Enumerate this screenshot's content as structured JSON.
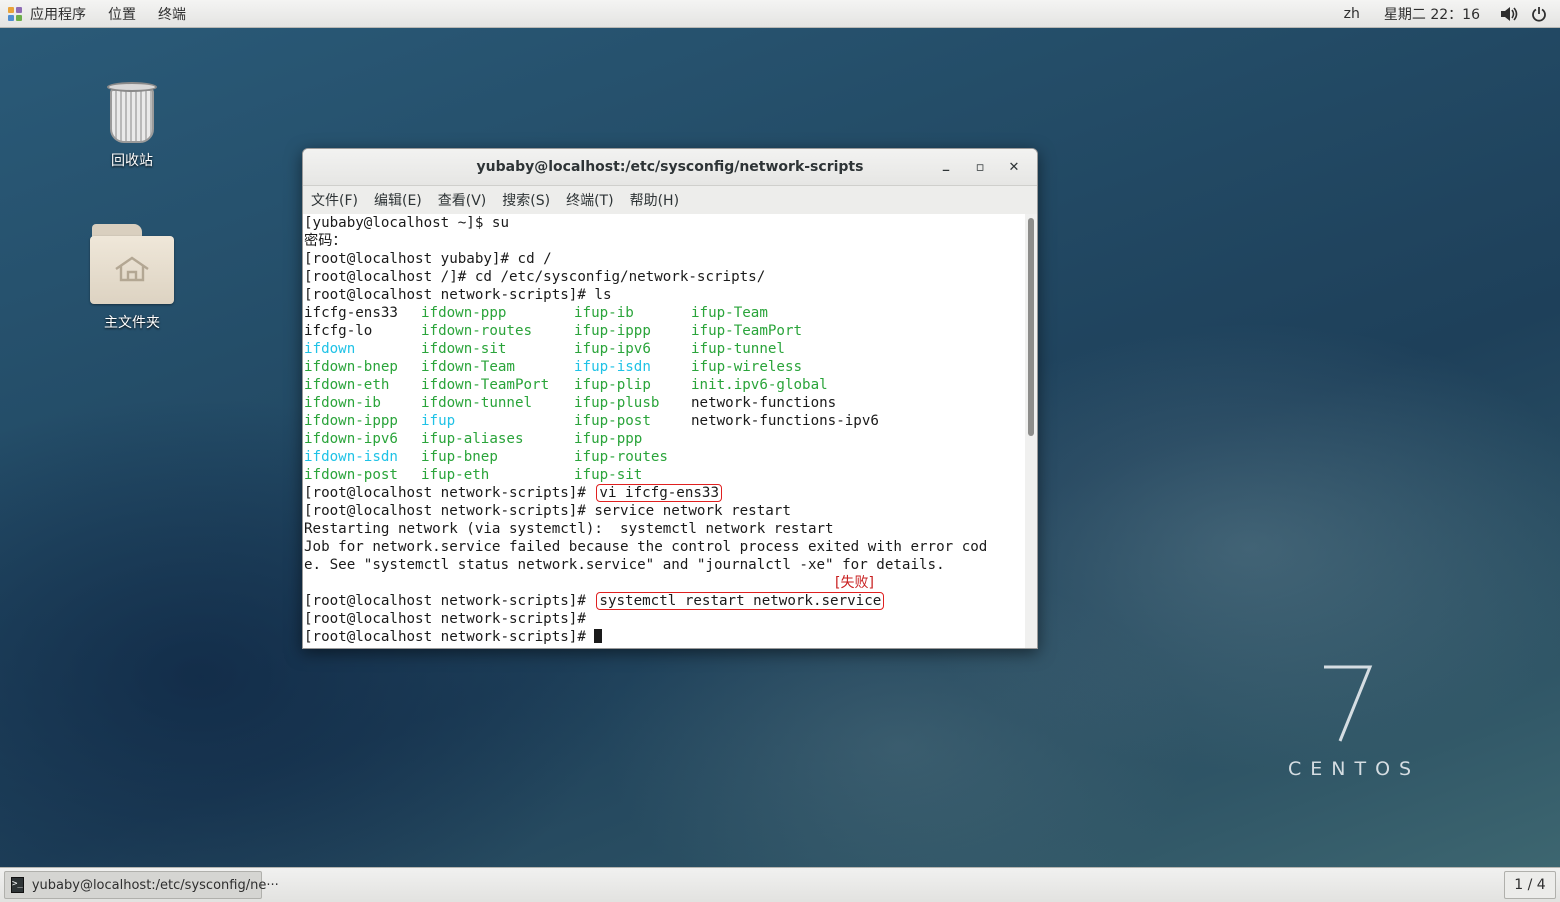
{
  "topbar": {
    "apps_label": "应用程序",
    "places_label": "位置",
    "terminal_label": "终端",
    "input_method": "zh",
    "clock": "星期二 22：16",
    "icons": [
      "apps-icon",
      "volume-icon",
      "power-icon"
    ]
  },
  "desktop": {
    "trash_label": "回收站",
    "home_label": "主文件夹"
  },
  "window": {
    "title": "yubaby@localhost:/etc/sysconfig/network-scripts",
    "controls": [
      "minimize",
      "maximize",
      "close"
    ],
    "minimize_glyph": "_",
    "maximize_glyph": "▫",
    "close_glyph": "✕"
  },
  "menubar": [
    "文件(F)",
    "编辑(E)",
    "查看(V)",
    "搜索(S)",
    "终端(T)",
    "帮助(H)"
  ],
  "terminal": {
    "lines_before_ls": [
      "[yubaby@localhost ~]$ su",
      "密码：",
      "[root@localhost yubaby]# cd /",
      "[root@localhost /]# cd /etc/sysconfig/network-scripts/",
      "[root@localhost network-scripts]# ls"
    ],
    "ls_rows": [
      [
        {
          "t": "ifcfg-ens33",
          "c": "k"
        },
        {
          "t": "ifdown-ppp",
          "c": "g"
        },
        {
          "t": "ifup-ib",
          "c": "g"
        },
        {
          "t": "ifup-Team",
          "c": "g"
        }
      ],
      [
        {
          "t": "ifcfg-lo",
          "c": "k"
        },
        {
          "t": "ifdown-routes",
          "c": "g"
        },
        {
          "t": "ifup-ippp",
          "c": "g"
        },
        {
          "t": "ifup-TeamPort",
          "c": "g"
        }
      ],
      [
        {
          "t": "ifdown",
          "c": "cy"
        },
        {
          "t": "ifdown-sit",
          "c": "g"
        },
        {
          "t": "ifup-ipv6",
          "c": "g"
        },
        {
          "t": "ifup-tunnel",
          "c": "g"
        }
      ],
      [
        {
          "t": "ifdown-bnep",
          "c": "g"
        },
        {
          "t": "ifdown-Team",
          "c": "g"
        },
        {
          "t": "ifup-isdn",
          "c": "cy"
        },
        {
          "t": "ifup-wireless",
          "c": "g"
        }
      ],
      [
        {
          "t": "ifdown-eth",
          "c": "g"
        },
        {
          "t": "ifdown-TeamPort",
          "c": "g"
        },
        {
          "t": "ifup-plip",
          "c": "g"
        },
        {
          "t": "init.ipv6-global",
          "c": "g"
        }
      ],
      [
        {
          "t": "ifdown-ib",
          "c": "g"
        },
        {
          "t": "ifdown-tunnel",
          "c": "g"
        },
        {
          "t": "ifup-plusb",
          "c": "g"
        },
        {
          "t": "network-functions",
          "c": "k"
        }
      ],
      [
        {
          "t": "ifdown-ippp",
          "c": "g"
        },
        {
          "t": "ifup",
          "c": "cy"
        },
        {
          "t": "ifup-post",
          "c": "g"
        },
        {
          "t": "network-functions-ipv6",
          "c": "k"
        }
      ],
      [
        {
          "t": "ifdown-ipv6",
          "c": "g"
        },
        {
          "t": "ifup-aliases",
          "c": "g"
        },
        {
          "t": "ifup-ppp",
          "c": "g"
        },
        {
          "t": "",
          "c": "k"
        }
      ],
      [
        {
          "t": "ifdown-isdn",
          "c": "cy"
        },
        {
          "t": "ifup-bnep",
          "c": "g"
        },
        {
          "t": "ifup-routes",
          "c": "g"
        },
        {
          "t": "",
          "c": "k"
        }
      ],
      [
        {
          "t": "ifdown-post",
          "c": "g"
        },
        {
          "t": "ifup-eth",
          "c": "g"
        },
        {
          "t": "ifup-sit",
          "c": "g"
        },
        {
          "t": "",
          "c": "k"
        }
      ]
    ],
    "prompt": "[root@localhost network-scripts]#",
    "cmd_vi": "vi ifcfg-ens33",
    "cmd_service": "service network restart",
    "restart_msg": "Restarting network (via systemctl):  systemctl network restart",
    "job_msg_1": "Job for network.service failed because the control process exited with error cod",
    "job_msg_2": "e. See \"systemctl status network.service\" and \"journalctl -xe\" for details.",
    "fail_tag": "[失败]",
    "cmd_systemctl": "systemctl restart network.service"
  },
  "logo": {
    "digit": "7",
    "word": "CENTOS"
  },
  "taskbar": {
    "task_title": "yubaby@localhost:/etc/sysconfig/ne···",
    "workspace": "1 / 4"
  },
  "colors": {
    "ls_green": "#2aa43a",
    "ls_cyan": "#1fc2e6",
    "highlight_red": "#e02020"
  }
}
